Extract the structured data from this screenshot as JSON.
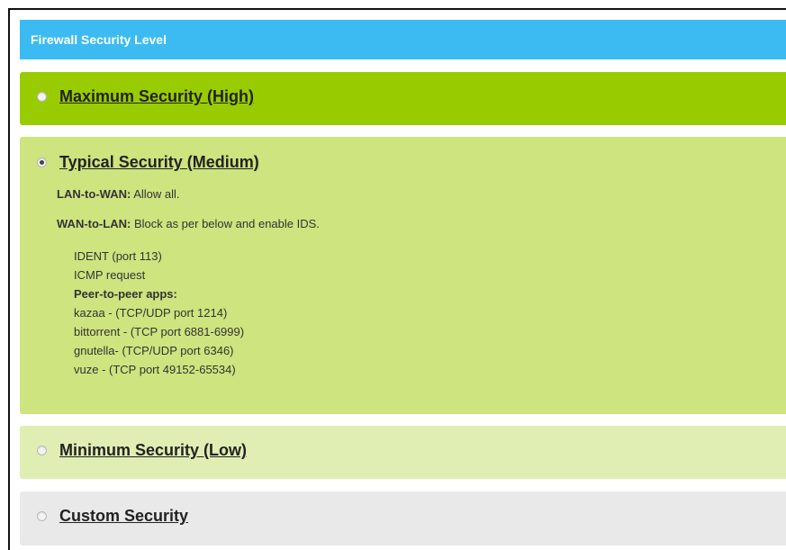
{
  "title": "Firewall Security Level",
  "options": [
    {
      "label": "Maximum Security (High)",
      "selected": false
    },
    {
      "label": "Typical Security (Medium)",
      "selected": true
    },
    {
      "label": "Minimum Security (Low)",
      "selected": false
    },
    {
      "label": "Custom Security",
      "selected": false
    }
  ],
  "medium_details": {
    "lan_to_wan": {
      "label": "LAN-to-WAN:",
      "text": "Allow all."
    },
    "wan_to_lan": {
      "label": "WAN-to-LAN:",
      "text": "Block as per below and enable IDS."
    },
    "items": [
      "IDENT (port 113)",
      "ICMP request"
    ],
    "p2p_heading": "Peer-to-peer apps:",
    "p2p_items": [
      "kazaa - (TCP/UDP port 1214)",
      "bittorrent - (TCP port 6881-6999)",
      "gnutella- (TCP/UDP port 6346)",
      "vuze - (TCP port 49152-65534)"
    ]
  },
  "colors": {
    "header": "#3bbbf2",
    "high": "#99cc00",
    "medium": "#cde47f",
    "low": "#e1eeb3",
    "custom": "#e9e9e9"
  }
}
